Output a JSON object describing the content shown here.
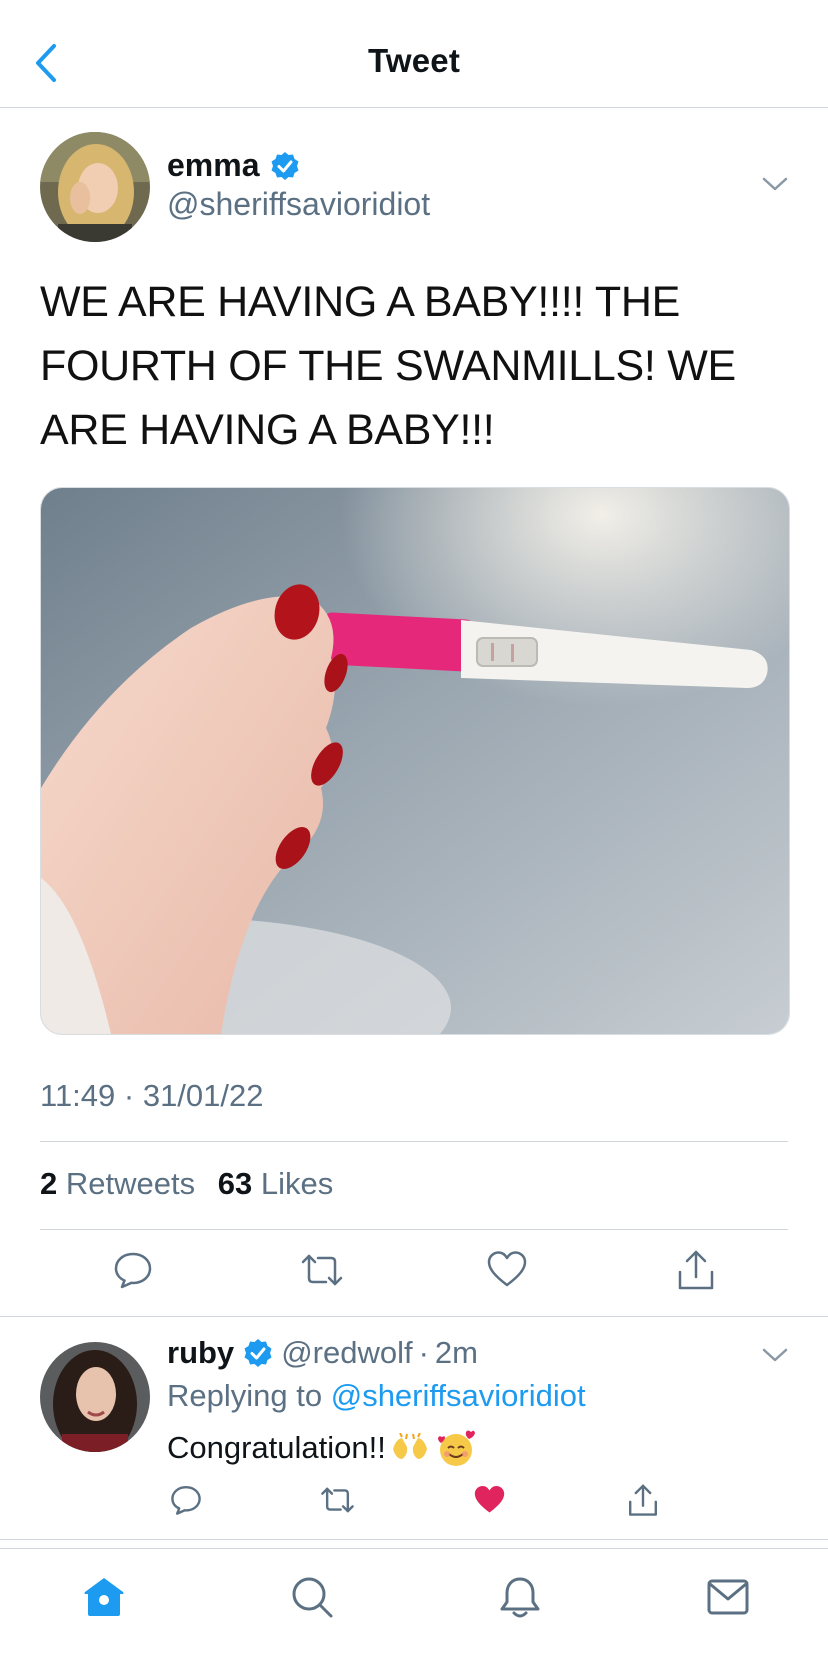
{
  "header": {
    "title": "Tweet"
  },
  "tweet": {
    "author_name": "emma",
    "author_handle": "@sheriffsavioridiot",
    "text": "WE ARE HAVING A BABY!!!! THE FOURTH OF THE SWANMILLS! WE ARE HAVING A BABY!!!",
    "timestamp": "11:49 · 31/01/22",
    "retweets_count": "2",
    "retweets_label": "Retweets",
    "likes_count": "63",
    "likes_label": "Likes"
  },
  "reply": {
    "author_name": "ruby",
    "author_handle": "@redwolf",
    "separator": "·",
    "time": "2m",
    "replying_prefix": "Replying to",
    "replying_to": "@sheriffsavioridiot",
    "text": "Congratulation!!",
    "liked": true
  },
  "colors": {
    "accent": "#1d9bf0",
    "like": "#e0245e",
    "muted": "#5b7083"
  },
  "tabbar": [
    "home-icon",
    "search-icon",
    "notifications-icon",
    "messages-icon"
  ]
}
